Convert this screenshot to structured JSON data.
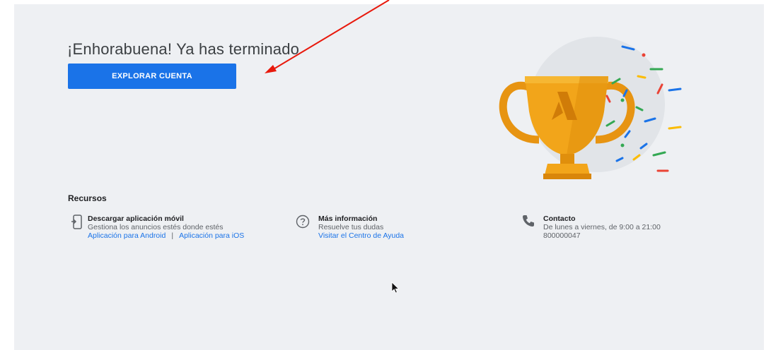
{
  "page": {
    "title": "¡Enhorabuena! Ya has terminado",
    "primary_button": "EXPLORAR CUENTA"
  },
  "resources": {
    "heading": "Recursos",
    "mobile": {
      "icon": "phone-download-icon",
      "title": "Descargar aplicación móvil",
      "subtitle": "Gestiona los anuncios estés donde estés",
      "android_link": "Aplicación para Android",
      "separator": "|",
      "ios_link": "Aplicación para iOS"
    },
    "info": {
      "icon": "help-circle-icon",
      "title": "Más información",
      "subtitle": "Resuelve tus dudas",
      "link": "Visitar el Centro de Ayuda"
    },
    "contact": {
      "icon": "phone-icon",
      "title": "Contacto",
      "hours": "De lunes a viernes, de 9:00 a 21:00",
      "phone": "800000047"
    }
  },
  "decor": {
    "trophy_icon": "trophy-icon",
    "confetti_colors": [
      "#1a73e8",
      "#34a853",
      "#fbbc04",
      "#ea4335"
    ],
    "annotation_arrow_color": "#e8190c"
  },
  "colors": {
    "accent": "#1a73e8",
    "panel_bg": "#eef0f3",
    "trophy_gold": "#f2a51a"
  }
}
